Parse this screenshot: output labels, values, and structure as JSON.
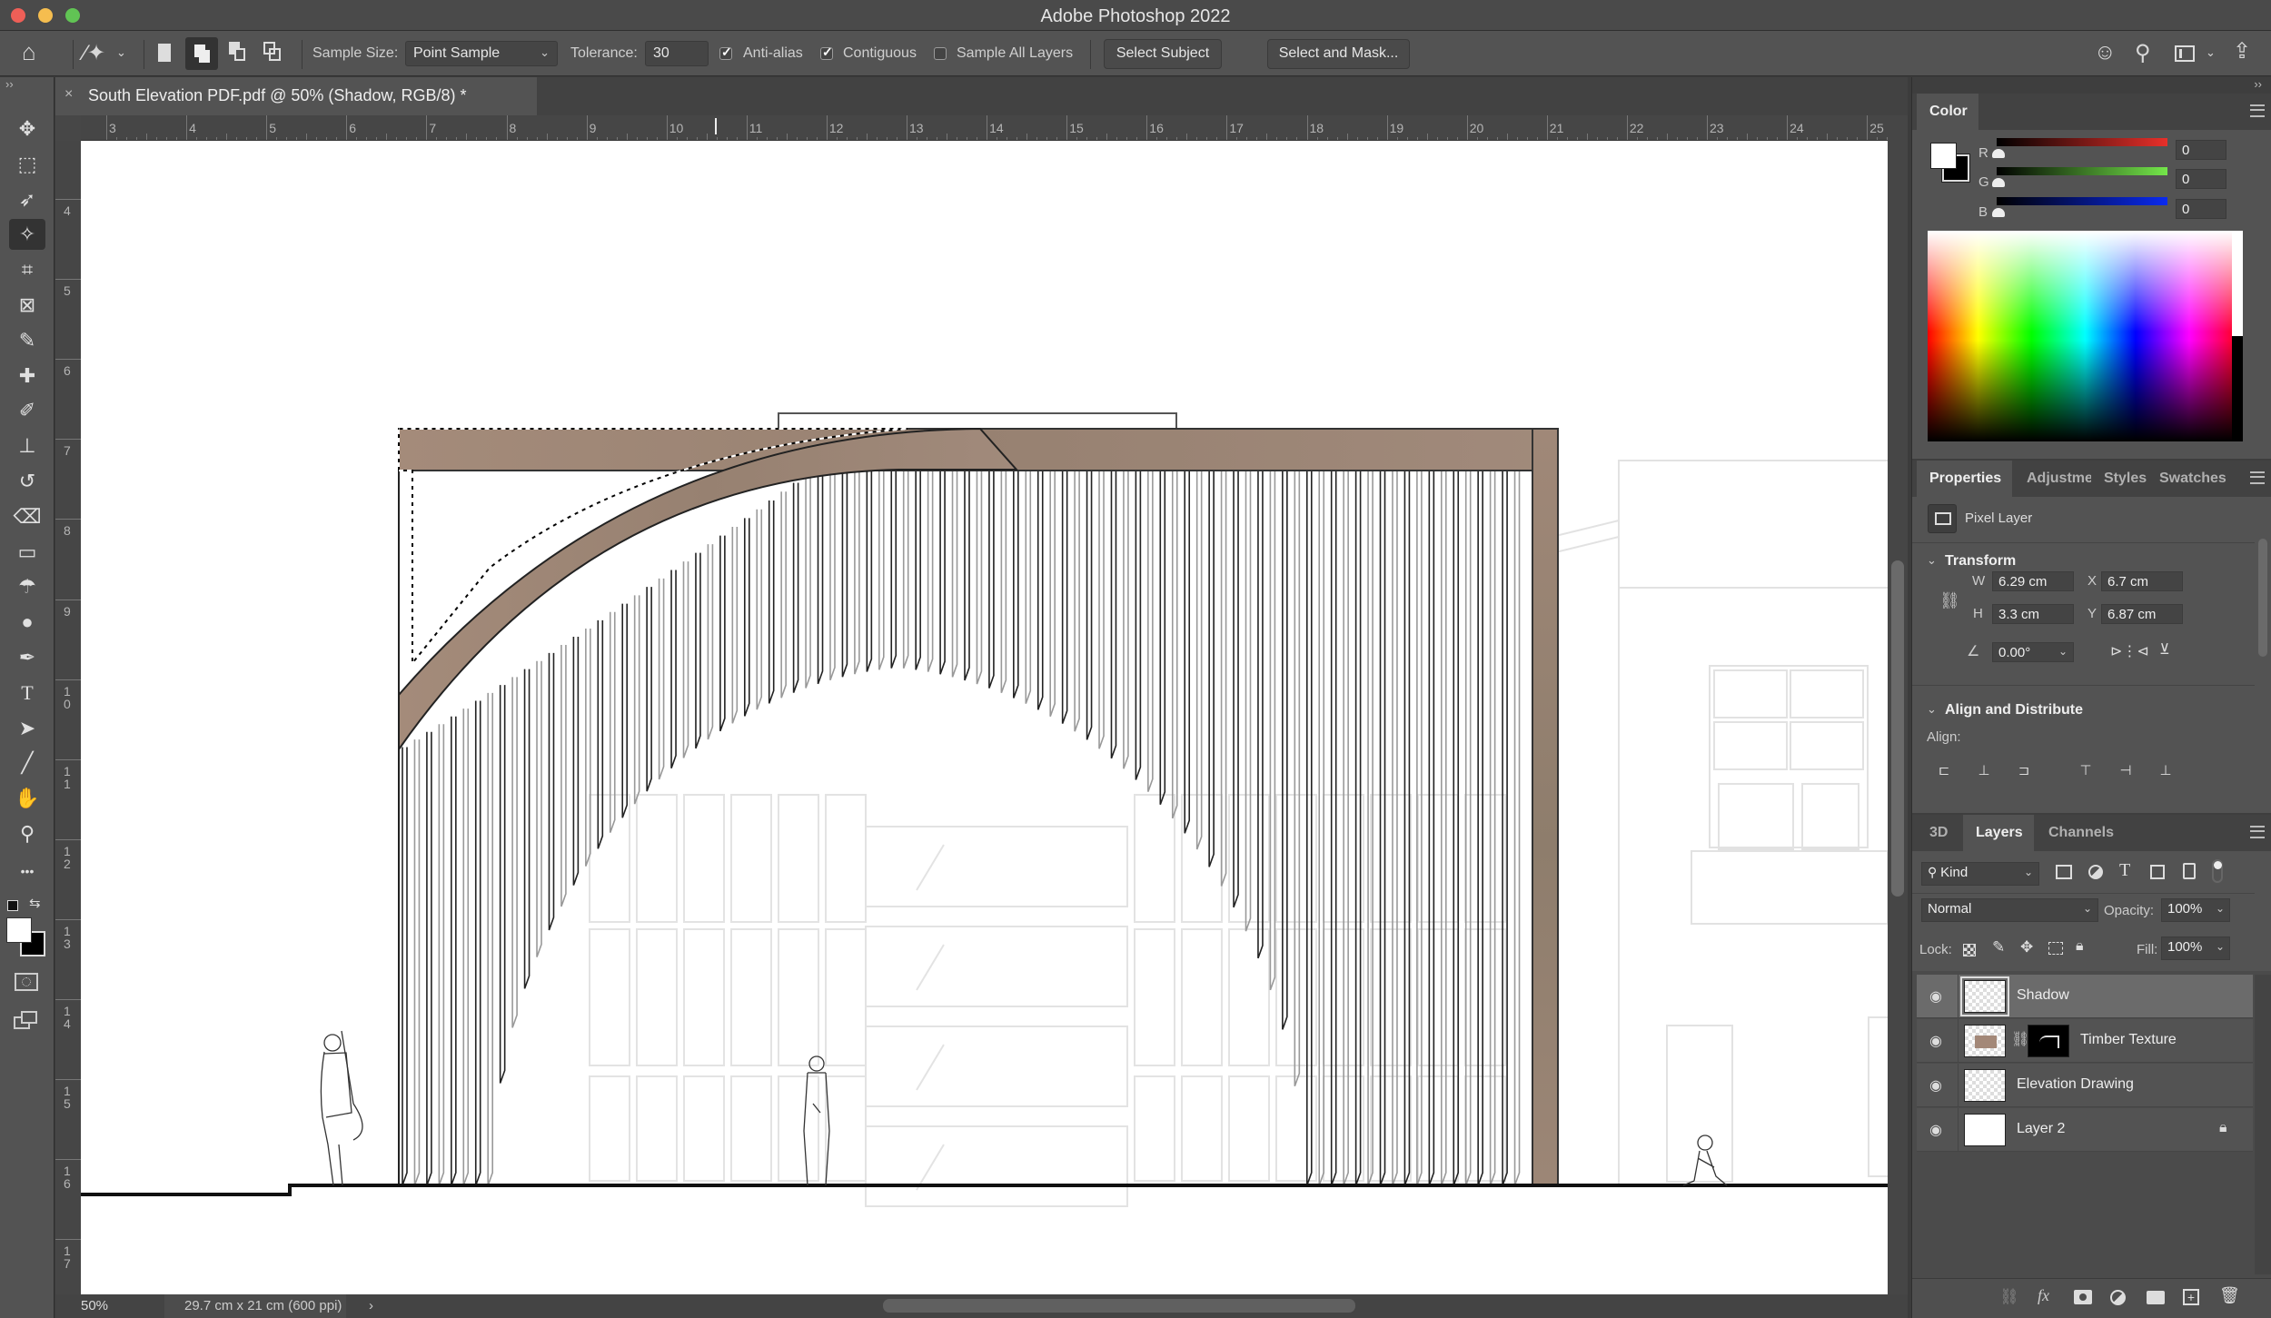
{
  "window": {
    "title": "Adobe Photoshop 2022",
    "traffic_lights": [
      {
        "name": "close",
        "color": "#ee5f57"
      },
      {
        "name": "minimize",
        "color": "#f5bd4f"
      },
      {
        "name": "maximize",
        "color": "#61c454"
      }
    ]
  },
  "options_bar": {
    "home_icon": "home-icon",
    "tool_icon": "magic-wand-icon",
    "selection_modes": [
      "new-selection",
      "add-to-selection",
      "subtract-from-selection",
      "intersect-with-selection"
    ],
    "active_selection_mode": "add-to-selection",
    "sample_size_label": "Sample Size:",
    "sample_size_value": "Point Sample",
    "tolerance_label": "Tolerance:",
    "tolerance_value": "30",
    "anti_alias_label": "Anti-alias",
    "anti_alias_checked": true,
    "contiguous_label": "Contiguous",
    "contiguous_checked": true,
    "sample_all_layers_label": "Sample All Layers",
    "sample_all_layers_checked": false,
    "select_subject_label": "Select Subject",
    "select_and_mask_label": "Select and Mask...",
    "right_icons": [
      "share-learn-icon",
      "search-icon",
      "workspace-icon",
      "share-icon"
    ]
  },
  "tools": [
    {
      "name": "move-tool",
      "glyph": "✥"
    },
    {
      "name": "marquee-tool",
      "glyph": "⬚"
    },
    {
      "name": "lasso-tool",
      "glyph": "➶"
    },
    {
      "name": "magic-wand-tool",
      "glyph": "✧",
      "active": true
    },
    {
      "name": "crop-tool",
      "glyph": "⌗"
    },
    {
      "name": "frame-tool",
      "glyph": "⊠"
    },
    {
      "name": "eyedropper-tool",
      "glyph": "✎"
    },
    {
      "name": "healing-brush-tool",
      "glyph": "✚"
    },
    {
      "name": "brush-tool",
      "glyph": "✐"
    },
    {
      "name": "clone-stamp-tool",
      "glyph": "⊥"
    },
    {
      "name": "history-brush-tool",
      "glyph": "↺"
    },
    {
      "name": "eraser-tool",
      "glyph": "⌫"
    },
    {
      "name": "gradient-tool",
      "glyph": "▭"
    },
    {
      "name": "blur-tool",
      "glyph": "☂"
    },
    {
      "name": "dodge-tool",
      "glyph": "●"
    },
    {
      "name": "pen-tool",
      "glyph": "✒"
    },
    {
      "name": "type-tool",
      "glyph": "T"
    },
    {
      "name": "path-selection-tool",
      "glyph": "➤"
    },
    {
      "name": "line-tool",
      "glyph": "╱"
    },
    {
      "name": "hand-tool",
      "glyph": "✋"
    },
    {
      "name": "zoom-tool",
      "glyph": "⚲"
    },
    {
      "name": "edit-toolbar",
      "glyph": "•••"
    }
  ],
  "document": {
    "tab_title": "South Elevation PDF.pdf @ 50% (Shadow, RGB/8) *",
    "close_glyph": "×"
  },
  "rulers": {
    "horizontal": [
      "3",
      "4",
      "5",
      "6",
      "7",
      "8",
      "9",
      "10",
      "11",
      "12",
      "13",
      "14",
      "15",
      "16",
      "17",
      "18",
      "19",
      "20",
      "21",
      "22",
      "23",
      "24",
      "25"
    ],
    "vertical": [
      "4",
      "5",
      "6",
      "7",
      "8",
      "9",
      "10",
      "11",
      "12",
      "13",
      "14",
      "15",
      "16",
      "17"
    ]
  },
  "status_bar": {
    "zoom": "50%",
    "doc_info": "29.7 cm x 21 cm (600 ppi)",
    "arrow": "›"
  },
  "color_panel": {
    "tab": "Color",
    "foreground": "#ffffff",
    "background": "#000000",
    "channels": [
      {
        "label": "R",
        "value": "0",
        "end_color": "#e8302a"
      },
      {
        "label": "G",
        "value": "0",
        "end_color": "#74e64a"
      },
      {
        "label": "B",
        "value": "0",
        "end_color": "#0a2af0"
      }
    ]
  },
  "properties_panel": {
    "tabs": [
      "Properties",
      "Adjustme",
      "Styles",
      "Swatches"
    ],
    "active_tab": "Properties",
    "layer_type": "Pixel Layer",
    "transform": {
      "title": "Transform",
      "w_label": "W",
      "w": "6.29 cm",
      "h_label": "H",
      "h": "3.3 cm",
      "x_label": "X",
      "x": "6.7 cm",
      "y_label": "Y",
      "y": "6.87 cm",
      "angle": "0.00°"
    },
    "align": {
      "title": "Align and Distribute",
      "label": "Align:",
      "buttons": [
        "align-left-edges",
        "align-horizontal-centers",
        "align-right-edges",
        "align-top-edges",
        "align-vertical-centers",
        "align-bottom-edges"
      ]
    }
  },
  "layers_panel": {
    "tabs": [
      "3D",
      "Layers",
      "Channels"
    ],
    "active_tab": "Layers",
    "filter_kind": "Kind",
    "blend_mode": "Normal",
    "opacity_label": "Opacity:",
    "opacity": "100%",
    "lock_label": "Lock:",
    "fill_label": "Fill:",
    "fill": "100%",
    "layers": [
      {
        "name": "Shadow",
        "visible": true,
        "selected": true,
        "locked": false,
        "thumb": "transparent"
      },
      {
        "name": "Timber Texture",
        "visible": true,
        "selected": false,
        "locked": false,
        "thumb": "timber",
        "has_mask": true
      },
      {
        "name": "Elevation Drawing",
        "visible": true,
        "selected": false,
        "locked": false,
        "thumb": "transparent"
      },
      {
        "name": "Layer 2",
        "visible": true,
        "selected": false,
        "locked": true,
        "thumb": "white"
      }
    ],
    "footer_icons": [
      "link-layers-icon",
      "fx-icon",
      "add-mask-icon",
      "adjustment-layer-icon",
      "group-folder-icon",
      "new-layer-icon",
      "trash-icon"
    ]
  },
  "canvas_content": {
    "timber_color": "#9e8878",
    "line_color": "#222222",
    "ghost_color": "#dddddd"
  }
}
